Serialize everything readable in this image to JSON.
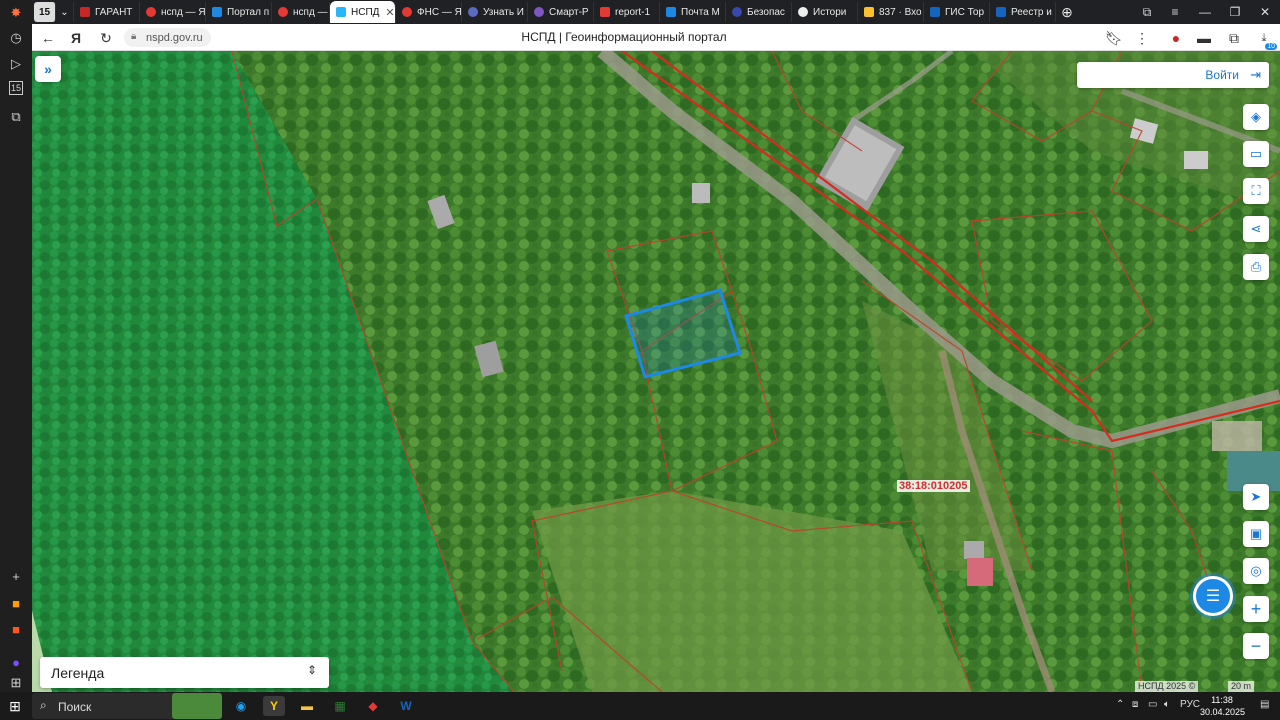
{
  "browser": {
    "tab_count": "15",
    "tabs": [
      {
        "label": "ГАРАНТ",
        "color": "#c62828"
      },
      {
        "label": "нспд — Я",
        "color": "#e53935"
      },
      {
        "label": "Портал п",
        "color": "#1e88e5"
      },
      {
        "label": "нспд — Я",
        "color": "#e53935"
      },
      {
        "label": "НСПД",
        "color": "#29b6f6",
        "active": true
      },
      {
        "label": "ФНС — Я",
        "color": "#e53935"
      },
      {
        "label": "Узнать И",
        "color": "#5c6bc0"
      },
      {
        "label": "Смарт-Р",
        "color": "#7e57c2"
      },
      {
        "label": "report-1",
        "color": "#e53935"
      },
      {
        "label": "Почта М",
        "color": "#1e88e5"
      },
      {
        "label": "Безопас",
        "color": "#3949ab"
      },
      {
        "label": "Истори",
        "color": "#eeeeee"
      },
      {
        "label": "837 · Вхо",
        "color": "#fbc02d"
      },
      {
        "label": "ГИС Тор",
        "color": "#1565c0"
      },
      {
        "label": "Реестр и",
        "color": "#1565c0"
      }
    ],
    "url": "nspd.gov.ru",
    "page_title": "НСПД | Геоинформационный портал",
    "download_badge": "10"
  },
  "map": {
    "login_label": "Войти",
    "cadastral_label": "38:18:010205",
    "legend_label": "Легенда",
    "attribution": "НСПД 2025 ©",
    "scale_label": "20 m",
    "selected_parcel_color": "#1e88e5",
    "boundary_color": "#d32f2f",
    "tools": [
      {
        "name": "layers-icon",
        "glyph": "◈"
      },
      {
        "name": "ruler-icon",
        "glyph": "▭"
      },
      {
        "name": "select-area-icon",
        "glyph": "⛶"
      },
      {
        "name": "share-icon",
        "glyph": "⋖"
      },
      {
        "name": "print-icon",
        "glyph": "⎙"
      },
      {
        "name": "locate-icon",
        "glyph": "➤"
      },
      {
        "name": "basemap-icon",
        "glyph": "▣"
      },
      {
        "name": "geo-search-icon",
        "glyph": "◎"
      },
      {
        "name": "zoom-in-icon",
        "glyph": "+"
      },
      {
        "name": "zoom-out-icon",
        "glyph": "−"
      }
    ]
  },
  "taskbar": {
    "search_label": "Поиск",
    "language": "РУС",
    "time": "11:38",
    "date": "30.04.2025"
  }
}
